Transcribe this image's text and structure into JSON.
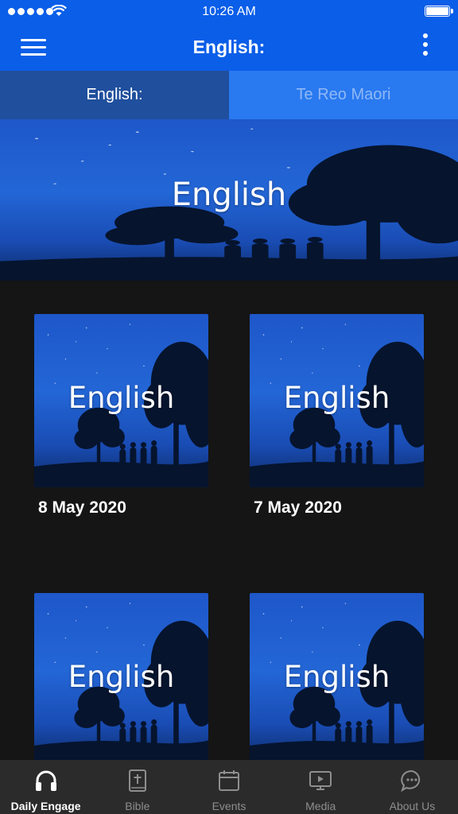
{
  "status_bar": {
    "time": "10:26 AM"
  },
  "nav": {
    "title": "English:"
  },
  "tabs": [
    {
      "label": "English:",
      "active": true
    },
    {
      "label": "Te Reo Maori",
      "active": false
    }
  ],
  "hero": {
    "label": "English"
  },
  "cards": [
    {
      "label": "English",
      "date": "8 May 2020"
    },
    {
      "label": "English",
      "date": "7 May 2020"
    },
    {
      "label": "English",
      "date": ""
    },
    {
      "label": "English",
      "date": ""
    }
  ],
  "tab_bar": [
    {
      "label": "Daily Engage",
      "icon": "headphones-icon",
      "active": true
    },
    {
      "label": "Bible",
      "icon": "bible-icon",
      "active": false
    },
    {
      "label": "Events",
      "icon": "calendar-icon",
      "active": false
    },
    {
      "label": "Media",
      "icon": "media-play-icon",
      "active": false
    },
    {
      "label": "About Us",
      "icon": "chat-bubble-icon",
      "active": false
    }
  ],
  "colors": {
    "primary": "#0a5ee8",
    "tab_active": "#1f4f9d",
    "tab_inactive": "#2979f0",
    "background": "#151515",
    "tab_bar": "#2b2b2b"
  }
}
